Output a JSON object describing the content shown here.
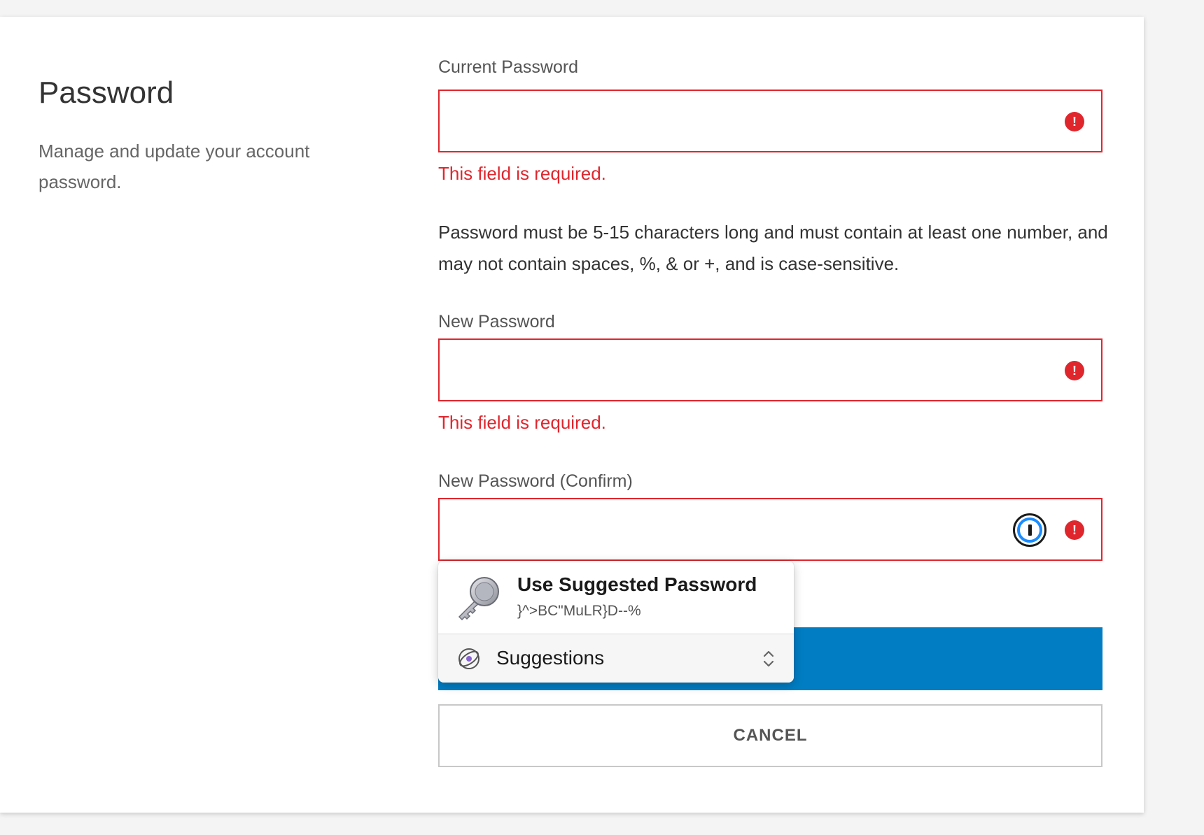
{
  "section": {
    "title": "Password",
    "description": "Manage and update your account password."
  },
  "fields": {
    "current": {
      "label": "Current Password",
      "value": "",
      "error": "This field is required."
    },
    "new": {
      "label": "New Password",
      "value": "",
      "error": "This field is required."
    },
    "confirm": {
      "label": "New Password (Confirm)",
      "value": ""
    }
  },
  "rules_text": "Password must be 5-15 characters long and must contain at least one number, and may not contain spaces, %, & or +, and is case-sensitive.",
  "error_icon": "!",
  "buttons": {
    "submit_label": "",
    "cancel_label": "CANCEL"
  },
  "popup": {
    "title": "Use Suggested Password",
    "suggested_password": "}^>BC\"MuLR}D--%",
    "menu_label": "Suggestions"
  },
  "icons": {
    "error": "error-circle-icon",
    "password_manager": "password-manager-icon",
    "key": "key-icon",
    "suggestions": "suggestions-icon",
    "chevron": "chevron-up-down-icon"
  },
  "colors": {
    "error": "#e0262d",
    "primary": "#007dc3",
    "password_manager_ring": "#1a8cff"
  }
}
